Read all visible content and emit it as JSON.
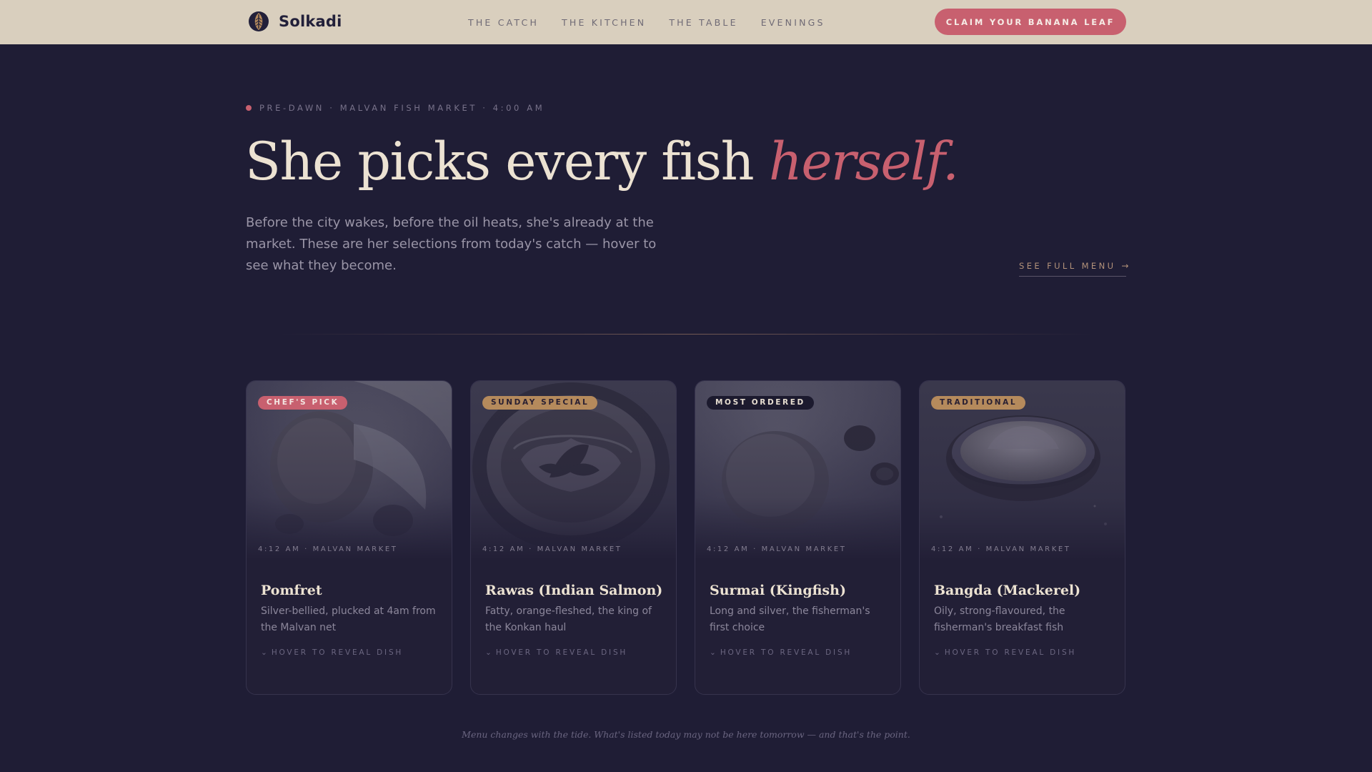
{
  "nav": {
    "brand": "Solkadi",
    "links": [
      "THE CATCH",
      "THE KITCHEN",
      "THE TABLE",
      "EVENINGS"
    ],
    "cta": "CLAIM YOUR BANANA LEAF"
  },
  "hero": {
    "eyebrow": "PRE-DAWN · MALVAN FISH MARKET · 4:00 AM",
    "title_main": "She picks every fish ",
    "title_em": "herself.",
    "subtitle": "Before the city wakes, before the oil heats, she's already at the market. These are her selections from today's catch — hover to see what they become.",
    "see_full_menu": "SEE FULL MENU",
    "see_full_arrow": "→"
  },
  "cards": [
    {
      "badge": "CHEF'S PICK",
      "badge_bg": "#c8606f",
      "badge_fg": "#f3e6e2",
      "time": "4:12 AM · MALVAN MARKET",
      "name": "Pomfret",
      "description": "Silver-bellied, plucked at 4am from the Malvan net",
      "hover": "HOVER TO REVEAL DISH",
      "hover_icon": "⌄"
    },
    {
      "badge": "SUNDAY SPECIAL",
      "badge_bg": "#b58a5c",
      "badge_fg": "#2a2032",
      "time": "4:12 AM · MALVAN MARKET",
      "name": "Rawas (Indian Salmon)",
      "description": "Fatty, orange-fleshed, the king of the Konkan haul",
      "hover": "HOVER TO REVEAL DISH",
      "hover_icon": "⌄"
    },
    {
      "badge": "MOST ORDERED",
      "badge_bg": "#1c1a2e",
      "badge_fg": "#e6ddd0",
      "time": "4:12 AM · MALVAN MARKET",
      "name": "Surmai (Kingfish)",
      "description": "Long and silver, the fisherman's first choice",
      "hover": "HOVER TO REVEAL DISH",
      "hover_icon": "⌄"
    },
    {
      "badge": "TRADITIONAL",
      "badge_bg": "#b58a5c",
      "badge_fg": "#2a2032",
      "time": "4:12 AM · MALVAN MARKET",
      "name": "Bangda (Mackerel)",
      "description": "Oily, strong-flavoured, the fisherman's breakfast fish",
      "hover": "HOVER TO REVEAL DISH",
      "hover_icon": "⌄"
    }
  ],
  "footnote": "Menu changes with the tide. What's listed today may not be here tomorrow — and that's the point.",
  "colors": {
    "background": "#1f1d35",
    "nav_bg": "#d9cfbe",
    "accent": "#c8606f",
    "gold": "#b58a5c"
  }
}
